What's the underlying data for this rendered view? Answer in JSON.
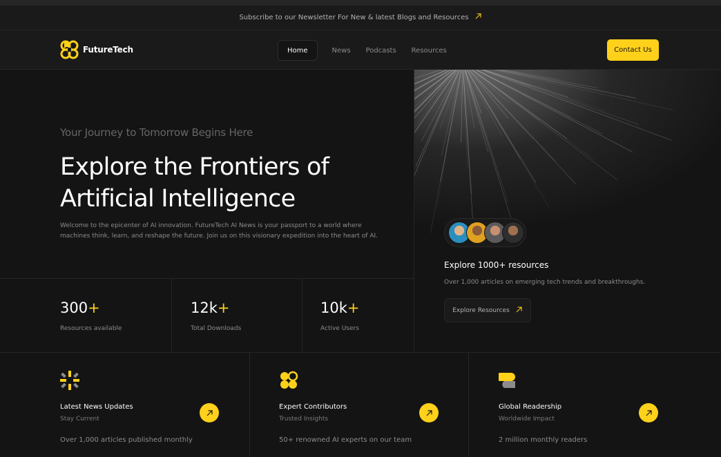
{
  "banner": {
    "text": "Subscribe to our Newsletter For New & latest Blogs and Resources",
    "icon": "arrow-up-right-icon"
  },
  "nav": {
    "brand": "FutureTech",
    "links": [
      "Home",
      "News",
      "Podcasts",
      "Resources"
    ],
    "active": "Home",
    "contact_label": "Contact Us"
  },
  "hero": {
    "eyebrow": "Your Journey to Tomorrow Begins Here",
    "headline_line1": "Explore the Frontiers of",
    "headline_line2": "Artificial Intelligence",
    "description": "Welcome to the epicenter of AI innovation. FutureTech AI News is your passport to a world where machines think, learn, and reshape the future. Join us on this visionary expedition into the heart of AI."
  },
  "stats": [
    {
      "value": "300",
      "suffix": "+",
      "label": "Resources available"
    },
    {
      "value": "12k",
      "suffix": "+",
      "label": "Total Downloads"
    },
    {
      "value": "10k",
      "suffix": "+",
      "label": "Active Users"
    }
  ],
  "resources": {
    "title": "Explore 1000+ resources",
    "subtitle": "Over 1,000 articles on emerging tech trends and breakthroughs.",
    "button_label": "Explore Resources"
  },
  "features": [
    {
      "title": "Latest News Updates",
      "subtitle": "Stay Current",
      "desc": "Over 1,000 articles published monthly",
      "icon": "sparkle-icon"
    },
    {
      "title": "Expert Contributors",
      "subtitle": "Trusted Insights",
      "desc": "50+ renowned AI experts on our team",
      "icon": "circles-icon"
    },
    {
      "title": "Global Readership",
      "subtitle": "Worldwide Impact",
      "desc": "2 million monthly readers",
      "icon": "layers-icon"
    }
  ],
  "colors": {
    "accent": "#ffd11a",
    "background": "#141414",
    "panel": "#1a1a1a",
    "border": "#262626"
  }
}
